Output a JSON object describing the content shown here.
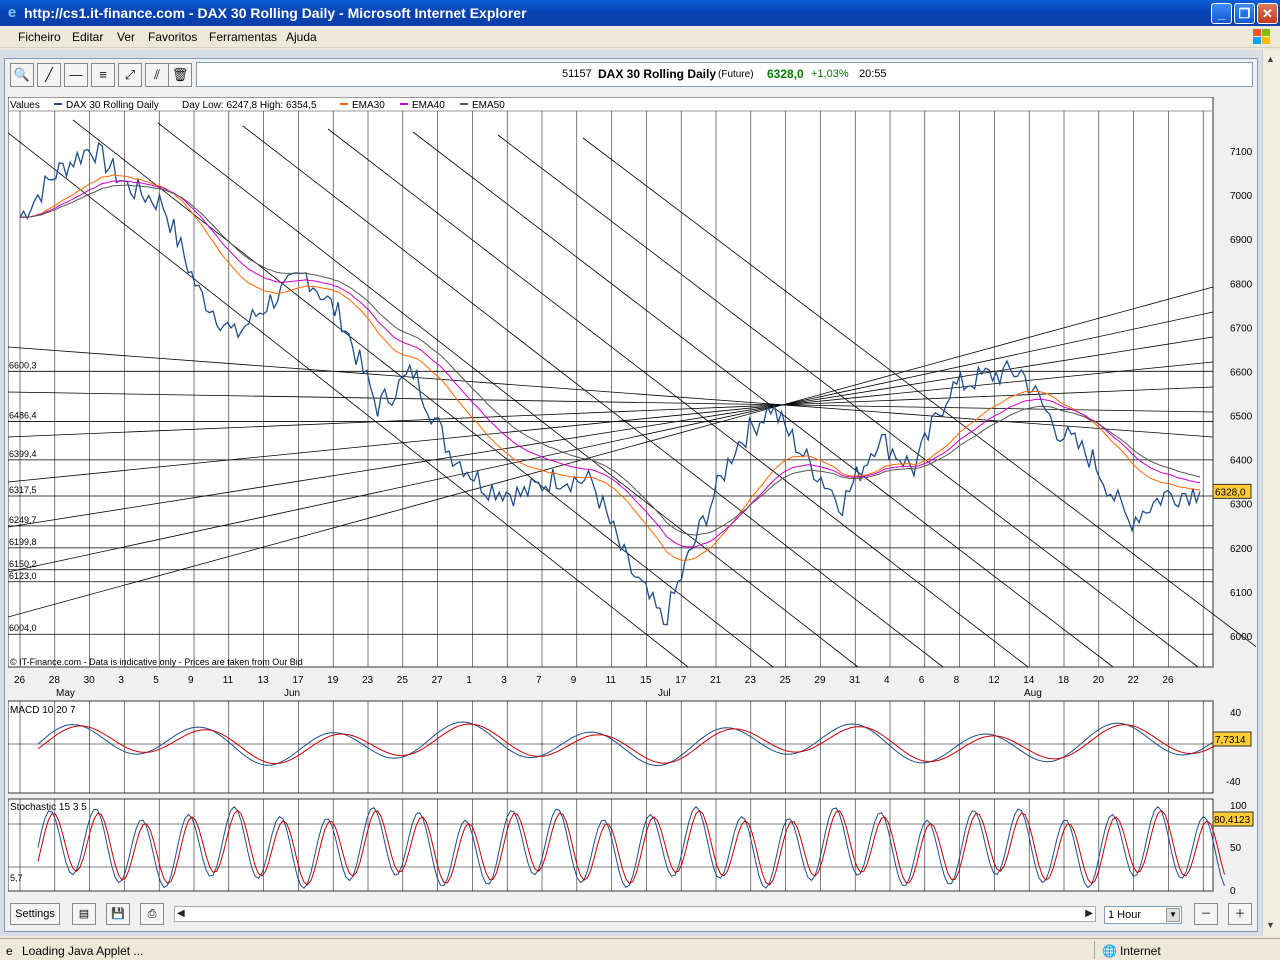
{
  "window": {
    "title": "http://cs1.it-finance.com - DAX 30 Rolling Daily - Microsoft Internet Explorer"
  },
  "menu": [
    "Ficheiro",
    "Editar",
    "Ver",
    "Favoritos",
    "Ferramentas",
    "Ajuda"
  ],
  "quote": {
    "id": "51157",
    "name": "DAX 30  Rolling Daily",
    "type": "(Future)",
    "price": "6328,0",
    "change": "+1,03%",
    "time": "20:55",
    "price_color": "#008000"
  },
  "toolbar_icons": [
    "zoom-icon",
    "trendline-icon",
    "horizontal-line-icon",
    "fibonacci-icon",
    "channel-icon",
    "parallel-lines-icon",
    "trash-icon"
  ],
  "main_chart": {
    "legend_values": "Values",
    "legend_series": "DAX 30  Rolling Daily",
    "legend_range": "Day Low: 6247,8 High: 6354,5",
    "legend_ema30": "EMA30",
    "legend_ema40": "EMA40",
    "legend_ema50": "EMA50",
    "disclaimer": "© IT-Finance.com - Data is indicative only - Prices are taken from Our Bid",
    "last_price_label": "6328,0",
    "y_ticks": [
      "7100",
      "7000",
      "6900",
      "6800",
      "6700",
      "6600",
      "6500",
      "6400",
      "6300",
      "6200",
      "6100",
      "6000"
    ],
    "h_levels": [
      "6600,3",
      "6486,4",
      "6399,4",
      "6317,5",
      "6249,7",
      "6199,8",
      "6150,2",
      "6123,0",
      "6004,0"
    ],
    "x_day_labels": [
      "26",
      "28",
      "30",
      "3",
      "5",
      "9",
      "11",
      "13",
      "17",
      "19",
      "23",
      "25",
      "27",
      "1",
      "3",
      "7",
      "9",
      "11",
      "15",
      "17",
      "21",
      "23",
      "25",
      "29",
      "31",
      "4",
      "6",
      "8",
      "12",
      "14",
      "18",
      "20",
      "22",
      "26"
    ],
    "x_month_labels": [
      "May",
      "Jun",
      "Jul",
      "Aug"
    ]
  },
  "macd": {
    "title": "MACD 10 20 7",
    "value_label": "7,7314",
    "y_ticks": [
      "40",
      "-40"
    ]
  },
  "stochastic": {
    "title": "Stochastic 15 3 5",
    "value_label": "80,4123",
    "level_label": "5,7",
    "y_ticks": [
      "100",
      "50",
      "0"
    ]
  },
  "bottom": {
    "settings": "Settings",
    "interval": "1 Hour"
  },
  "status": {
    "text": "Loading Java Applet ...",
    "zone": "Internet"
  },
  "colors": {
    "price": "#1f4e8c",
    "ema30": "#ff6600",
    "ema40": "#cc00cc",
    "ema50": "#555555",
    "value_badge": "#ffcc33"
  },
  "chart_data": {
    "type": "line",
    "title": "DAX 30  Rolling Daily",
    "xlabel": "",
    "ylabel": "",
    "ylim": [
      5940,
      7230
    ],
    "x_range": [
      "May 26",
      "Aug 27"
    ],
    "grid": true,
    "legend_position": "top-left",
    "series": [
      {
        "name": "DAX 30  Rolling Daily",
        "x": [
          "May 26",
          "May 28",
          "May 30",
          "Jun 3",
          "Jun 5",
          "Jun 9",
          "Jun 11",
          "Jun 13",
          "Jun 17",
          "Jun 19",
          "Jun 23",
          "Jun 25",
          "Jun 27",
          "Jul 1",
          "Jul 3",
          "Jul 7",
          "Jul 9",
          "Jul 11",
          "Jul 15",
          "Jul 17",
          "Jul 21",
          "Jul 23",
          "Jul 25",
          "Jul 29",
          "Jul 31",
          "Aug 4",
          "Aug 6",
          "Aug 8",
          "Aug 12",
          "Aug 14",
          "Aug 18",
          "Aug 20",
          "Aug 22",
          "Aug 26"
        ],
        "values": [
          6950,
          7050,
          7110,
          7020,
          6980,
          6780,
          6680,
          6760,
          6820,
          6720,
          6520,
          6600,
          6420,
          6340,
          6320,
          6360,
          6350,
          6160,
          6030,
          6240,
          6430,
          6520,
          6400,
          6300,
          6450,
          6380,
          6560,
          6590,
          6600,
          6470,
          6400,
          6260,
          6320,
          6328
        ]
      }
    ]
  }
}
